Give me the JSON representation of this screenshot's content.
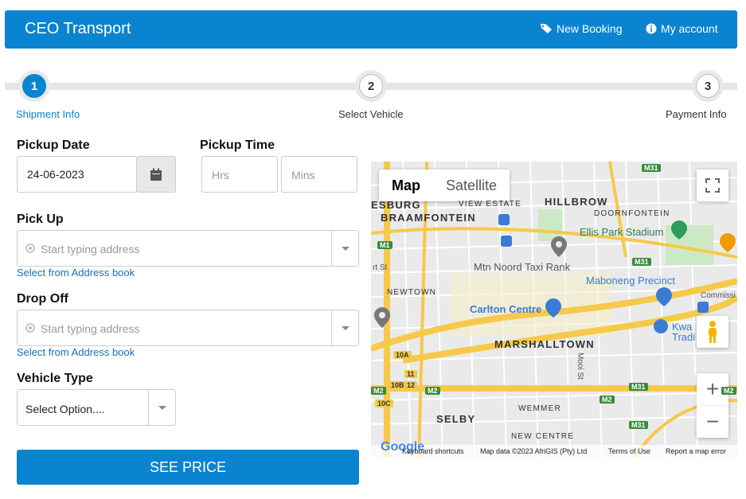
{
  "header": {
    "brand": "CEO Transport",
    "new_booking": "New Booking",
    "my_account": "My account"
  },
  "steps": [
    {
      "number": "1",
      "label": "Shipment Info",
      "active": true
    },
    {
      "number": "2",
      "label": "Select Vehicle",
      "active": false
    },
    {
      "number": "3",
      "label": "Payment Info",
      "active": false
    }
  ],
  "form": {
    "pickup_date_label": "Pickup Date",
    "pickup_date_value": "24-06-2023",
    "pickup_time_label": "Pickup Time",
    "hrs_placeholder": "Hrs",
    "mins_placeholder": "Mins",
    "pickup_label": "Pick Up",
    "pickup_placeholder": "Start typing address",
    "pickup_address_book": "Select from Address book",
    "dropoff_label": "Drop Off",
    "dropoff_placeholder": "Start typing address",
    "dropoff_address_book": "Select from Address book",
    "vehicle_type_label": "Vehicle Type",
    "vehicle_type_value": "Select Option....",
    "see_price": "SEE PRICE"
  },
  "map": {
    "tab_map": "Map",
    "tab_satellite": "Satellite",
    "labels": {
      "esburg": "ESBURG",
      "braamfontein": "BRAAMFONTEIN",
      "view_estate": "VIEW ESTATE",
      "hillbrow": "HILLBROW",
      "doornfontein": "DOORNFONTEIN",
      "ellis_park": "Ellis Park Stadium",
      "taxi_rank": "Mtn Noord Taxi Rank",
      "maboneng": "Maboneng Precinct",
      "newtown": "NEWTOWN",
      "carlton": "Carlton Centre",
      "marshalltown": "MARSHALLTOWN",
      "kwa": "Kwa",
      "tradi": "Tradi",
      "commissi": "Commissi",
      "wemmer": "WEMMER",
      "selby": "SELBY",
      "new_centre": "NEW CENTRE",
      "mooi_st": "Mooi St",
      "rt_st": "rt St"
    },
    "routes": [
      "M31",
      "M1",
      "M31",
      "M2",
      "M2",
      "M31",
      "M31",
      "10A",
      "10B",
      "10C",
      "11",
      "12",
      "M2",
      "M2"
    ],
    "footer": {
      "logo": "Google",
      "shortcuts": "Keyboard shortcuts",
      "data": "Map data ©2023 AfriGIS (Pty) Ltd",
      "terms": "Terms of Use",
      "report": "Report a map error"
    },
    "colors": {
      "highway": "#f6c94a",
      "road": "#ffffff",
      "block": "#e4e4e4",
      "park": "#cde8c4",
      "poi_blue": "#3a7bd5",
      "poi_green": "#2e9c5a"
    }
  },
  "accent_color": "#0a84d0"
}
